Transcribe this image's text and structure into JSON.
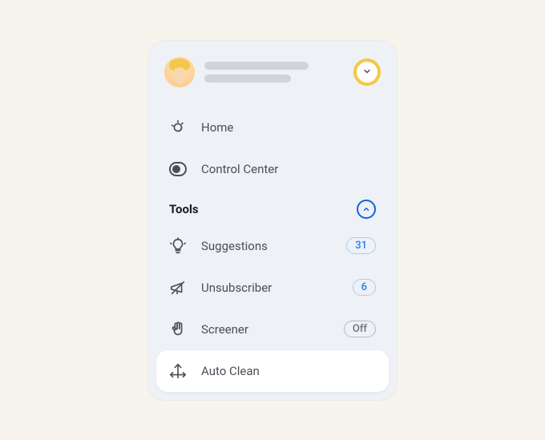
{
  "header": {
    "avatar": "user-avatar"
  },
  "nav": {
    "home": {
      "label": "Home"
    },
    "control_center": {
      "label": "Control Center"
    }
  },
  "tools_section": {
    "title": "Tools",
    "items": {
      "suggestions": {
        "label": "Suggestions",
        "badge": "31"
      },
      "unsubscriber": {
        "label": "Unsubscriber",
        "badge": "6"
      },
      "screener": {
        "label": "Screener",
        "badge": "Off"
      },
      "auto_clean": {
        "label": "Auto Clean"
      }
    }
  }
}
